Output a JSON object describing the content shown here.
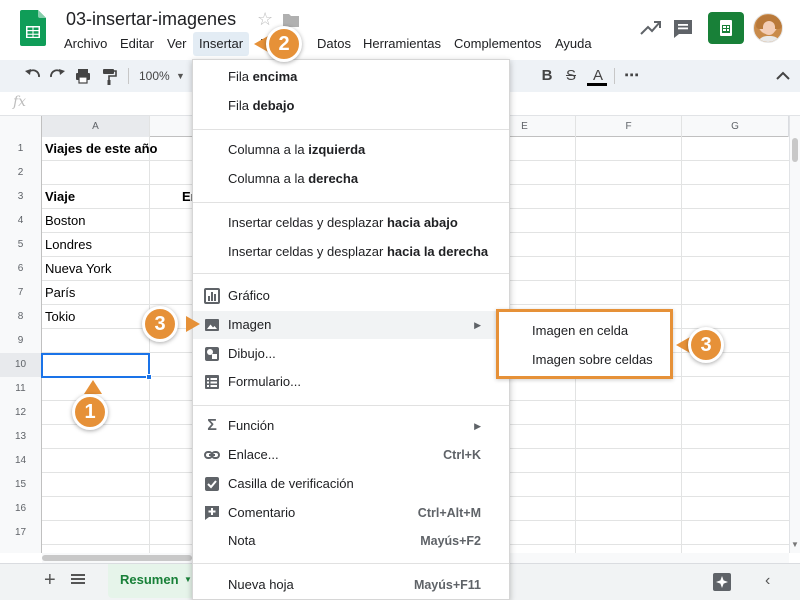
{
  "app": {
    "doc_title": "03-insertar-imagenes",
    "menu": [
      "Archivo",
      "Editar",
      "Ver",
      "Insertar",
      "Formato",
      "Datos",
      "Herramientas",
      "Complementos",
      "Ayuda"
    ],
    "menu_visible": {
      "formato_fragment": "F"
    }
  },
  "toolbar": {
    "zoom": "100%",
    "bold": "B",
    "strike": "S",
    "text_color": "A",
    "more": "⋯"
  },
  "formula_bar": {
    "fx": "fx",
    "value": ""
  },
  "grid": {
    "columns": [
      "A",
      "B",
      "C",
      "D",
      "E",
      "F",
      "G"
    ],
    "rows": [
      "1",
      "2",
      "3",
      "4",
      "5",
      "6",
      "7",
      "8",
      "9",
      "10",
      "11",
      "12",
      "13",
      "14",
      "15",
      "16",
      "17"
    ],
    "cells": {
      "A1": "Viajes de este año",
      "A3": "Viaje",
      "B3_fragment": "En",
      "A4": "Boston",
      "A5": "Londres",
      "A6": "Nueva York",
      "A7": "París",
      "A8": "Tokio"
    },
    "selected_cell": "A10"
  },
  "sheets": {
    "active": "Resumen"
  },
  "insert_menu": {
    "items": [
      {
        "pre": "Fila ",
        "bold": "encima"
      },
      {
        "pre": "Fila ",
        "bold": "debajo"
      },
      {
        "pre": "Columna a la ",
        "bold": "izquierda"
      },
      {
        "pre": "Columna a la ",
        "bold": "derecha"
      },
      {
        "pre": "Insertar celdas y desplazar ",
        "bold": "hacia abajo"
      },
      {
        "pre": "Insertar celdas y desplazar ",
        "bold": "hacia la derecha"
      },
      {
        "label": "Gráfico",
        "icon": "chart-icon"
      },
      {
        "label": "Imagen",
        "icon": "image-icon",
        "submenu": true
      },
      {
        "label": "Dibujo...",
        "icon": "drawing-icon"
      },
      {
        "label": "Formulario...",
        "icon": "form-icon"
      },
      {
        "label": "Función",
        "icon": "sigma-icon",
        "submenu": true
      },
      {
        "label": "Enlace...",
        "icon": "link-icon",
        "shortcut": "Ctrl+K"
      },
      {
        "label": "Casilla de verificación",
        "icon": "checkbox-icon"
      },
      {
        "label": "Comentario",
        "icon": "comment-add-icon",
        "shortcut": "Ctrl+Alt+M"
      },
      {
        "label": "Nota",
        "shortcut": "Mayús+F2"
      },
      {
        "label": "Nueva hoja",
        "shortcut": "Mayús+F11"
      }
    ]
  },
  "image_submenu": {
    "items": [
      "Imagen en celda",
      "Imagen sobre celdas"
    ]
  },
  "callouts": [
    "1",
    "2",
    "3",
    "3"
  ],
  "colors": {
    "accent": "#e69138",
    "sheets_green": "#188038",
    "selection_blue": "#1a73e8"
  }
}
